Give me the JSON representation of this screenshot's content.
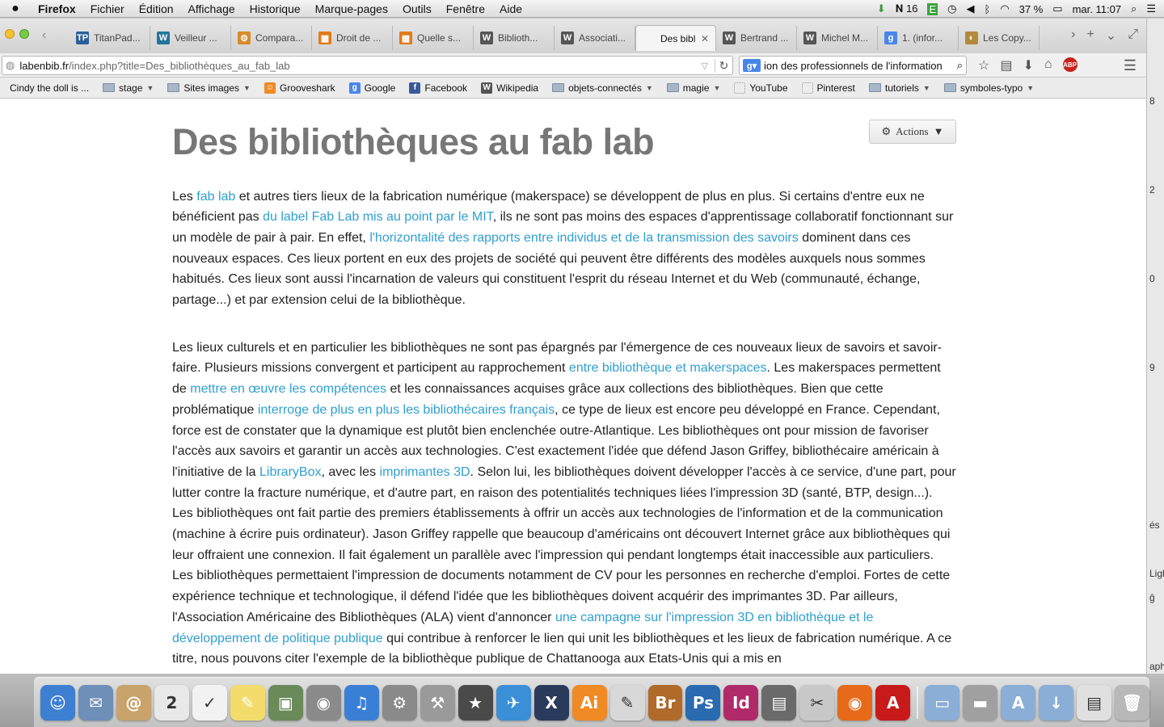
{
  "menubar": {
    "app_name": "Firefox",
    "items": [
      "Fichier",
      "Édition",
      "Affichage",
      "Historique",
      "Marque-pages",
      "Outils",
      "Fenêtre",
      "Aide"
    ],
    "status": {
      "wifi_badge": "16",
      "battery": "37 %",
      "clock": "mar. 11:07"
    }
  },
  "tabs": [
    {
      "label": "TitanPad...",
      "icon": "TP",
      "color": "#2d5f9a"
    },
    {
      "label": "Veilleur ...",
      "icon": "W",
      "color": "#21759b"
    },
    {
      "label": "Compara...",
      "icon": "⚙",
      "color": "#d98a2b"
    },
    {
      "label": "Droit de ...",
      "icon": "▦",
      "color": "#e07b1c"
    },
    {
      "label": "Quelle s...",
      "icon": "▦",
      "color": "#e07b1c"
    },
    {
      "label": "Biblioth...",
      "icon": "W",
      "color": "#555555"
    },
    {
      "label": "Associati...",
      "icon": "W",
      "color": "#555555"
    },
    {
      "label": "Des bibli...",
      "icon": "",
      "color": "#ffffff",
      "active": true
    },
    {
      "label": "Bertrand ...",
      "icon": "W",
      "color": "#555555"
    },
    {
      "label": "Michel M...",
      "icon": "W",
      "color": "#555555"
    },
    {
      "label": "1. (infor...",
      "icon": "g",
      "color": "#4a86e8"
    },
    {
      "label": "Les Copy...",
      "icon": "◐",
      "color": "#b38a3a"
    }
  ],
  "navbar": {
    "url_host": "labenbib.fr",
    "url_path": "/index.php?title=Des_bibliothèques_au_fab_lab",
    "search_text": "ion des professionnels de l'information",
    "abp_label": "ABP"
  },
  "bookmarks": [
    {
      "label": "Cindy the doll is ...",
      "type": "none"
    },
    {
      "label": "stage",
      "type": "folder"
    },
    {
      "label": "Sites images",
      "type": "folder"
    },
    {
      "label": "Grooveshark",
      "type": "icon",
      "icon": "☺",
      "color": "#f08a24"
    },
    {
      "label": "Google",
      "type": "icon",
      "icon": "g",
      "color": "#4a86e8"
    },
    {
      "label": "Facebook",
      "type": "icon",
      "icon": "f",
      "color": "#3b5998"
    },
    {
      "label": "Wikipedia",
      "type": "icon",
      "icon": "W",
      "color": "#555555"
    },
    {
      "label": "objets-connectés",
      "type": "folder"
    },
    {
      "label": "magie",
      "type": "folder"
    },
    {
      "label": "YouTube",
      "type": "icon",
      "icon": "",
      "color": "#ffffff"
    },
    {
      "label": "Pinterest",
      "type": "icon",
      "icon": "",
      "color": "#ffffff"
    },
    {
      "label": "tutoriels",
      "type": "folder"
    },
    {
      "label": "symboles-typo",
      "type": "folder"
    }
  ],
  "page": {
    "actions_label": "Actions",
    "title": "Des bibliothèques au fab lab",
    "paragraphs": [
      [
        {
          "t": "Les "
        },
        {
          "t": "fab lab",
          "link": true
        },
        {
          "t": " et autres tiers lieux de la fabrication numérique (makerspace) se développent de plus en plus. Si certains d'entre eux ne bénéficient pas "
        },
        {
          "t": "du label Fab Lab mis au point par le MIT",
          "link": true
        },
        {
          "t": ", ils ne sont pas moins des espaces d'apprentissage collaboratif fonctionnant sur un modèle de pair à pair. En effet, "
        },
        {
          "t": "l'horizontalité des rapports entre individus et de la transmission des savoirs",
          "link": true
        },
        {
          "t": " dominent dans ces nouveaux espaces. Ces lieux portent en eux des projets de société qui peuvent être différents des modèles auxquels nous sommes habitués. Ces lieux sont aussi l'incarnation de valeurs qui constituent l'esprit du réseau Internet et du Web (communauté, échange, partage...) et par extension celui de la bibliothèque."
        }
      ],
      [
        {
          "t": "Les lieux culturels et en particulier les bibliothèques ne sont pas épargnés par l'émergence de ces nouveaux lieux de savoirs et savoir-faire. Plusieurs missions convergent et participent au rapprochement "
        },
        {
          "t": "entre bibliothèque et makerspaces",
          "link": true
        },
        {
          "t": ". Les makerspaces permettent de "
        },
        {
          "t": "mettre en œuvre les compétences",
          "link": true
        },
        {
          "t": " et les connaissances acquises grâce aux collections des bibliothèques. Bien que cette problématique "
        },
        {
          "t": "interroge de plus en plus les bibliothécaires français",
          "link": true
        },
        {
          "t": ", ce type de lieux est encore peu développé en France. Cependant, force est de constater que la dynamique est plutôt bien enclenchée outre-Atlantique. Les bibliothèques ont pour mission de favoriser l'accès aux savoirs et garantir un accès aux technologies. C'est exactement l'idée que défend Jason Griffey, bibliothécaire américain à l'initiative de la "
        },
        {
          "t": "LibraryBox",
          "link": true
        },
        {
          "t": ", avec les "
        },
        {
          "t": "imprimantes 3D",
          "link": true
        },
        {
          "t": ". Selon lui, les bibliothèques doivent développer l'accès à ce service, d'une part, pour lutter contre la fracture numérique, et d'autre part, en raison des potentialités techniques liées l'impression 3D (santé, BTP, design...). Les bibliothèques ont fait partie des premiers établissements à offrir un accès aux technologies de l'information et de la communication (machine à écrire puis ordinateur). Jason Griffey rappelle que beaucoup d'américains ont découvert Internet grâce aux bibliothèques qui leur offraient une connexion. Il fait également un parallèle avec l'impression qui pendant longtemps était inaccessible aux particuliers. Les bibliothèques permettaient l'impression de documents notamment de CV pour les personnes en recherche d'emploi. Fortes de cette expérience technique et technologique, il défend l'idée que les bibliothèques doivent acquérir des imprimantes 3D. Par ailleurs, l'Association Américaine des Bibliothèques (ALA) vient d'annoncer "
        },
        {
          "t": "une campagne sur l'impression 3D en bibliothèque et le développement de politique publique",
          "link": true
        },
        {
          "t": " qui contribue à renforcer le lien qui unit les bibliothèques et les lieux de fabrication numérique. A ce titre, nous pouvons citer l'exemple de la bibliothèque publique de Chattanooga aux Etats-Unis qui a mis en"
        }
      ]
    ]
  },
  "edge_labels": [
    "8",
    "2",
    "0",
    "9",
    "és",
    "Ligh",
    "ĝ",
    "aph"
  ],
  "dock": [
    {
      "name": "finder",
      "glyph": "☺",
      "color": "#3d7fd1"
    },
    {
      "name": "mail",
      "glyph": "✉",
      "color": "#6d8fb8"
    },
    {
      "name": "contacts",
      "glyph": "@",
      "color": "#c9a36b"
    },
    {
      "name": "calendar",
      "glyph": "2",
      "color": "#e8e8e8"
    },
    {
      "name": "reminders",
      "glyph": "✓",
      "color": "#f2f2f2"
    },
    {
      "name": "notes",
      "glyph": "✎",
      "color": "#f3dc6b"
    },
    {
      "name": "iphoto",
      "glyph": "▣",
      "color": "#6a8a5a"
    },
    {
      "name": "camera",
      "glyph": "◉",
      "color": "#8a8a8a"
    },
    {
      "name": "itunes",
      "glyph": "♫",
      "color": "#3a7fd6"
    },
    {
      "name": "system-prefs",
      "glyph": "⚙",
      "color": "#8a8a8a"
    },
    {
      "name": "automator",
      "glyph": "⚒",
      "color": "#9a9a9a"
    },
    {
      "name": "imovie",
      "glyph": "★",
      "color": "#4a4a4a"
    },
    {
      "name": "mail-2",
      "glyph": "✈",
      "color": "#3a8fd6"
    },
    {
      "name": "x11",
      "glyph": "X",
      "color": "#2a3a5a"
    },
    {
      "name": "illustrator",
      "glyph": "Ai",
      "color": "#f08a24"
    },
    {
      "name": "textedit",
      "glyph": "✎",
      "color": "#d8d8d8"
    },
    {
      "name": "bridge",
      "glyph": "Br",
      "color": "#b06a2a"
    },
    {
      "name": "photoshop",
      "glyph": "Ps",
      "color": "#2a6ab0"
    },
    {
      "name": "indesign",
      "glyph": "Id",
      "color": "#b02a6a"
    },
    {
      "name": "preview",
      "glyph": "▤",
      "color": "#6a6a6a"
    },
    {
      "name": "scissors",
      "glyph": "✂",
      "color": "#c8c8c8"
    },
    {
      "name": "firefox",
      "glyph": "◉",
      "color": "#e66a1a"
    },
    {
      "name": "acrobat",
      "glyph": "A",
      "color": "#c81a1a"
    },
    {
      "name": "documents",
      "glyph": "▭",
      "color": "#8aaed6"
    },
    {
      "name": "disk",
      "glyph": "▬",
      "color": "#a0a0a0"
    },
    {
      "name": "applications",
      "glyph": "A",
      "color": "#8aaed6"
    },
    {
      "name": "downloads",
      "glyph": "↓",
      "color": "#8aaed6"
    },
    {
      "name": "stack",
      "glyph": "▤",
      "color": "#e0e0e0"
    },
    {
      "name": "trash",
      "glyph": "🗑",
      "color": "#b8b8b8"
    }
  ]
}
